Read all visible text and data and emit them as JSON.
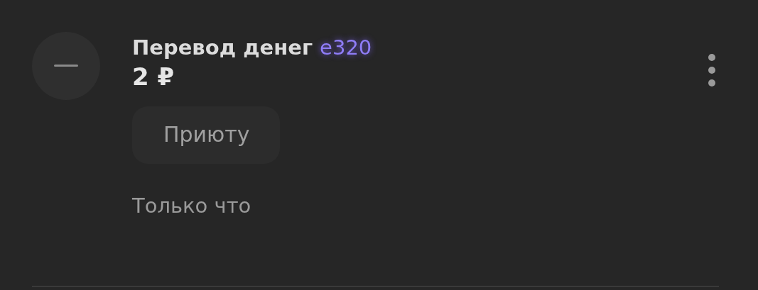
{
  "transaction": {
    "title": "Перевод денег",
    "tag": "e320",
    "amount": "2 ₽",
    "recipient": "Приюту",
    "time": "Только что"
  }
}
